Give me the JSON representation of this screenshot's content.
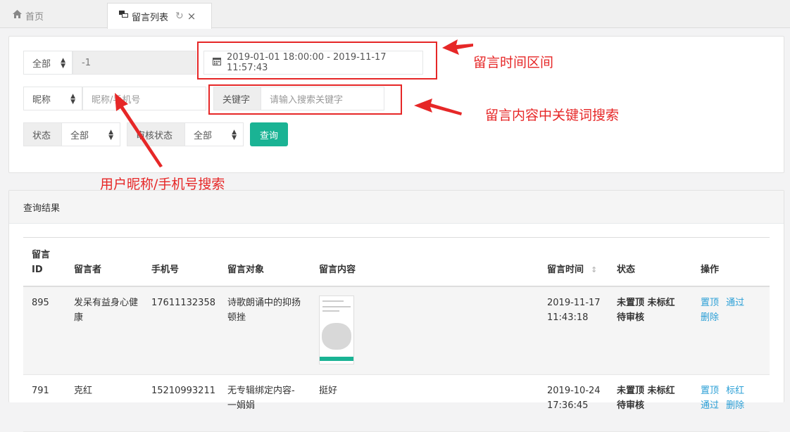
{
  "tabs": {
    "home_label": "首页",
    "active_label": "留言列表",
    "refresh_glyph": "↻",
    "close_glyph": "×"
  },
  "filters": {
    "scope_select": "全部",
    "scope_value": "-1",
    "date_range": "2019-01-01 18:00:00 - 2019-11-17 11:57:43",
    "nick_select": "昵称",
    "nick_placeholder": "昵称/手机号",
    "keyword_label": "关键字",
    "keyword_placeholder": "请输入搜索关键字",
    "status_label": "状态",
    "status_select": "全部",
    "review_label": "审核状态",
    "review_select": "全部",
    "query_button": "查询"
  },
  "result": {
    "title": "查询结果",
    "columns": [
      "留言\nID",
      "留言者",
      "手机号",
      "留言对象",
      "留言内容",
      "留言时间",
      "状态",
      "操作"
    ],
    "rows": [
      {
        "id": "895",
        "author": "发呆有益身心健康",
        "phone": "17611132358",
        "target": "诗歌朗诵中的抑扬顿挫",
        "content": "",
        "time": "2019-11-17 11:43:18",
        "status": "未置顶  未标红  待审核",
        "actions": [
          "置顶",
          "通过",
          "删除"
        ]
      },
      {
        "id": "791",
        "author": "克红",
        "phone": "15210993211",
        "target": "无专辑绑定内容-一娟娟",
        "content": "挺好",
        "time": "2019-10-24 17:36:45",
        "status": "未置顶  未标红  待审核",
        "actions": [
          "置顶",
          "标红",
          "通过",
          "删除"
        ]
      }
    ]
  },
  "annotations": {
    "time_range": "留言时间区间",
    "keyword": "留言内容中关键词搜索",
    "nick": "用户昵称/手机号搜索"
  },
  "colors": {
    "accent_green": "#1ab394",
    "link_blue": "#2a9fd6",
    "annotation_red": "#e62727"
  }
}
